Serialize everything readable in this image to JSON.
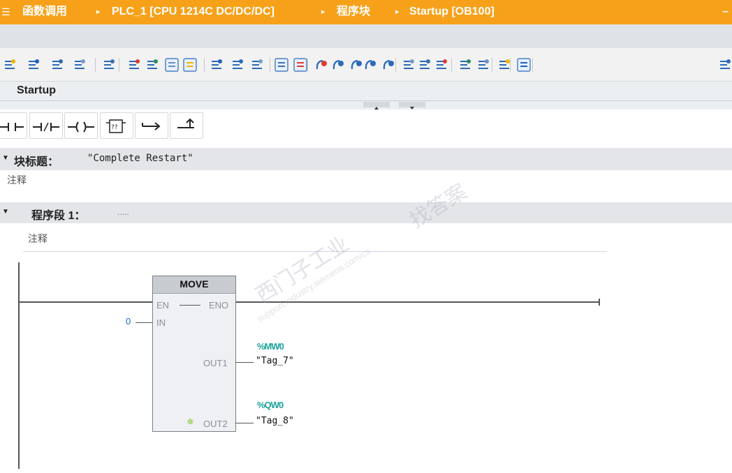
{
  "titlebar": {
    "menu_icon": "menu-icon",
    "crumbs": [
      "函数调用",
      "PLC_1 [CPU 1214C DC/DC/DC]",
      "程序块",
      "Startup [OB100]"
    ],
    "separator": "▸",
    "minimize": "–",
    "bg_color": "#f7a11a"
  },
  "toolbar": {
    "icons": [
      "insert-network-icon",
      "delete-network-icon",
      "insert-row-icon",
      "add-row-icon",
      "lock-icon",
      "align-left-icon",
      "box-icon",
      "collapse-icon",
      "comment-icon",
      "absolute-operands-icon",
      "symbol-operands-icon",
      "symbol-absolute-icon",
      "view-icon",
      "favorites-icon",
      "reset-breakpoint-icon",
      "delete-breakpoint-icon",
      "go-to-icon",
      "go-to-next-icon",
      "show-monitoring-icon",
      "first-icon",
      "step-icon",
      "step-next-icon",
      "jump-back-icon",
      "jump-forward-icon",
      "call-structure-icon",
      "monitor-icon",
      "more-icon"
    ]
  },
  "editor": {
    "tab_label": "Startup",
    "ladder_icons": [
      "contact-no-icon",
      "contact-nc-icon",
      "coil-icon",
      "empty-box-icon",
      "open-branch-icon",
      "close-branch-icon"
    ]
  },
  "block": {
    "title_label": "块标题：",
    "title_value": "\"Complete Restart\"",
    "comment": "注释"
  },
  "network": {
    "label": "程序段 1：",
    "dots": ".....",
    "comment": "注释"
  },
  "fb": {
    "name": "MOVE",
    "en": "EN",
    "eno": "ENO",
    "in": "IN",
    "in_value": "0",
    "out1": "OUT1",
    "out1_addr": "%MW0",
    "out1_tag": "\"Tag_7\"",
    "out2": "OUT2",
    "out2_addr": "%QW0",
    "out2_tag": "\"Tag_8\"",
    "add_pin_icon": "add-pin-icon"
  },
  "watermark": {
    "line1": "西门子工业",
    "line2": "support.industry.siemens.com/cs",
    "line3": "找答案"
  }
}
